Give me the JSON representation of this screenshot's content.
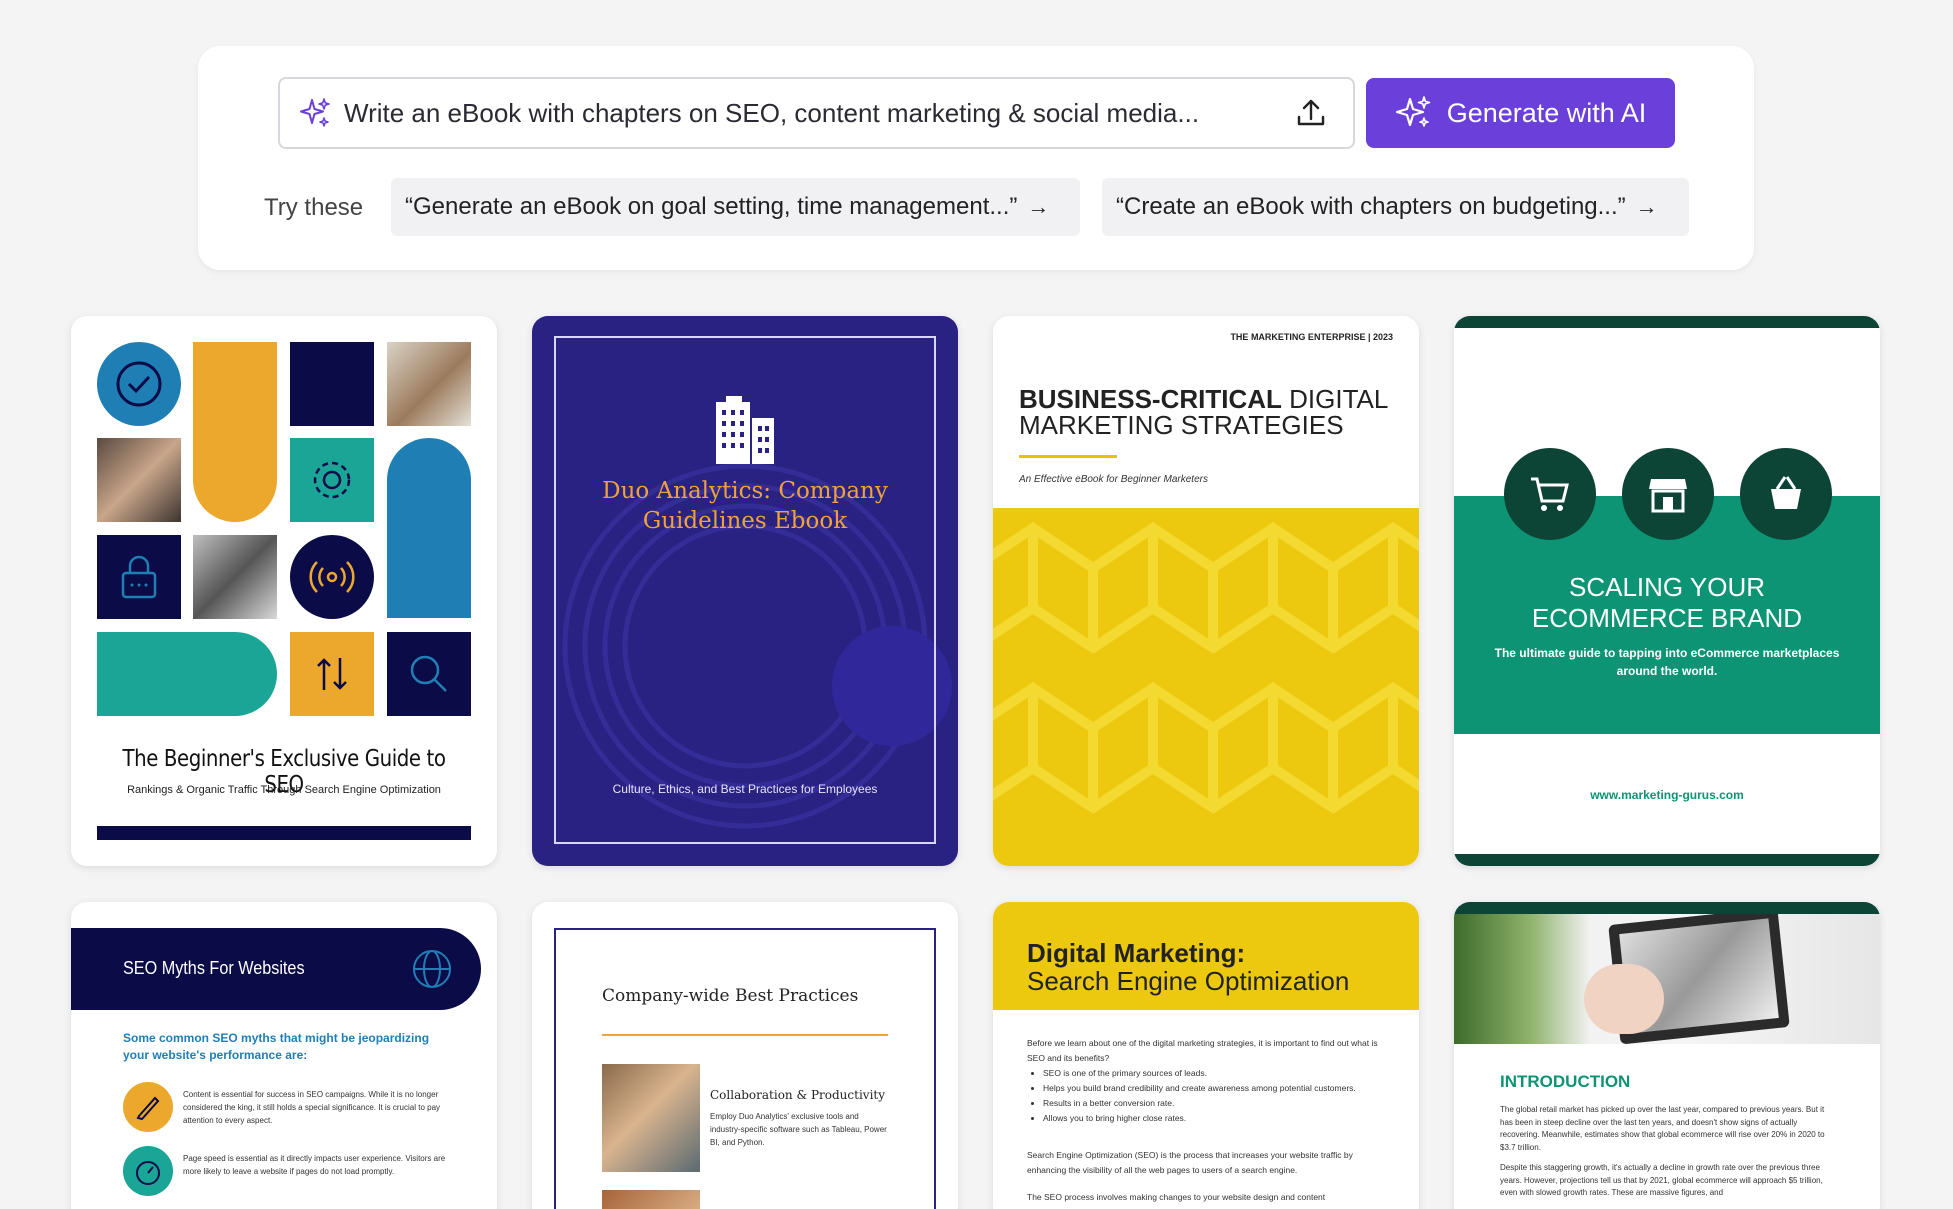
{
  "prompt_bar": {
    "input_value": "Write an eBook with chapters on SEO, content marketing & social media...",
    "generate_label": "Generate with AI",
    "accent_color": "#6b3fd9"
  },
  "suggestions": {
    "label": "Try these",
    "chips": [
      "“Generate an eBook on goal setting, time management...”",
      "“Create an eBook with chapters on budgeting...”"
    ],
    "arrow": "→"
  },
  "templates": {
    "seo_guide": {
      "title": "The Beginner's Exclusive Guide to SEO",
      "subtitle": "Rankings & Organic Traffic Through Search Engine Optimization"
    },
    "duo": {
      "title": "Duo Analytics: Company Guidelines Ebook",
      "subtitle": "Culture, Ethics, and Best Practices for Employees"
    },
    "business": {
      "header": "THE MARKETING ENTERPRISE | 2023",
      "title_bold": "BUSINESS-CRITICAL",
      "title_rest": " DIGITAL MARKETING STRATEGIES",
      "subtitle": "An Effective eBook for Beginner Marketers"
    },
    "ecommerce": {
      "title_line1": "SCALING YOUR",
      "title_line2": "ECOMMERCE BRAND",
      "subtitle": "The ultimate guide to tapping into eCommerce marketplaces around the world.",
      "url": "www.marketing-gurus.com"
    },
    "myths": {
      "title": "SEO Myths For Websites",
      "subtitle": "Some common SEO myths that might be jeopardizing your website's performance are:",
      "items": [
        "Content is essential for success in SEO campaigns. While it is no longer considered the king, it still holds a special significance. It is crucial to pay attention to every aspect.",
        "Page speed is essential as it directly impacts user experience. Visitors are more likely to leave a website if pages do not load promptly."
      ]
    },
    "best_practices": {
      "title": "Company-wide Best Practices",
      "item_title": "Collaboration & Productivity",
      "item_text": "Employ Duo Analytics' exclusive tools and industry-specific software such as Tableau, Power BI, and Python."
    },
    "digital_marketing": {
      "title_line1": "Digital Marketing:",
      "title_line2": "Search Engine Optimization",
      "intro": "Before we learn about one of the digital marketing strategies, it is important to find out what is SEO and its benefits?",
      "bullets": [
        "SEO is one of the primary sources of leads.",
        "Helps you build brand credibility and create awareness among potential customers.",
        "Results in a better conversion rate.",
        "Allows you to bring higher close rates."
      ],
      "para2": "Search Engine Optimization (SEO) is the process that increases your website traffic by enhancing the visibility of all the web pages to users of a search engine.",
      "para3": "The SEO process involves making changes to your website design and content"
    },
    "introduction": {
      "heading": "INTRODUCTION",
      "para1": "The global retail market has picked up over the last year, compared to previous years. But it has been in steep decline over the last ten years, and doesn't show signs of actually recovering. Meanwhile, estimates show that global ecommerce will rise over 20% in 2020 to $3.7 trillion.",
      "para2": "Despite this staggering growth, it's actually a decline in growth rate over the previous three years. However, projections tell us that by 2021, global ecommerce will approach $5 trillion, even with slowed growth rates. These are massive figures, and"
    }
  }
}
